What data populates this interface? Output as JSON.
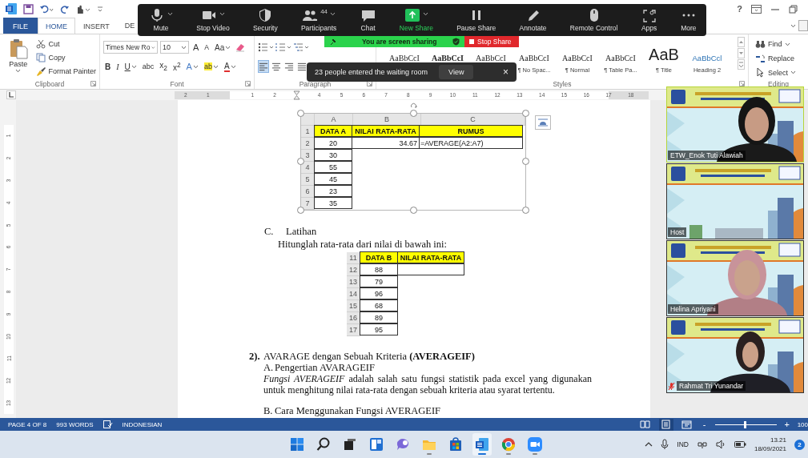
{
  "window_controls": {
    "help": "?"
  },
  "ribbon_tabs": [
    {
      "label": "FILE",
      "kind": "file",
      "selected": false
    },
    {
      "label": "HOME",
      "kind": "tab",
      "selected": true
    },
    {
      "label": "INSERT",
      "kind": "tab",
      "selected": false
    },
    {
      "label": "DE",
      "kind": "tab",
      "selected": false
    }
  ],
  "clipboard": {
    "label": "Clipboard",
    "paste": "Paste",
    "items": [
      {
        "kind": "cut",
        "label": "Cut"
      },
      {
        "kind": "copy",
        "label": "Copy"
      },
      {
        "kind": "painter",
        "label": "Format Painter"
      }
    ]
  },
  "font": {
    "label": "Font",
    "name": "Times New Ro",
    "size": "10",
    "row1": [
      {
        "kind": "grow",
        "text": "A"
      },
      {
        "kind": "shrink",
        "text": "A"
      },
      {
        "kind": "case",
        "text": "Aa"
      },
      {
        "kind": "clear"
      }
    ],
    "row2": [
      {
        "kind": "bold",
        "text": "B"
      },
      {
        "kind": "italic",
        "text": "I"
      },
      {
        "kind": "underline",
        "text": "U"
      },
      {
        "kind": "strike",
        "text": "abc"
      },
      {
        "kind": "sub",
        "text": "x$_{2}$"
      },
      {
        "kind": "sup",
        "text": "x$^{2}$"
      },
      {
        "kind": "effects",
        "text": "A"
      },
      {
        "kind": "highlight",
        "text": "ab"
      },
      {
        "kind": "color",
        "text": "A"
      }
    ]
  },
  "paragraph": {
    "label": "Paragraph",
    "alignments": [
      {
        "kind": "left",
        "selected": true
      },
      {
        "kind": "center",
        "selected": false
      },
      {
        "kind": "right",
        "selected": false
      },
      {
        "kind": "justify",
        "selected": false
      }
    ]
  },
  "styles": {
    "label": "Styles",
    "items": [
      {
        "kind": "body",
        "sample": "AaBbCcI"
      },
      {
        "kind": "heading1",
        "sample": "AaBbCcI"
      },
      {
        "kind": "list",
        "sample": "AaBbCcI"
      },
      {
        "kind": "plain",
        "sample": "AaBbCcI",
        "name": "¶ No Spac..."
      },
      {
        "kind": "plain",
        "sample": "AaBbCcI",
        "name": "¶ Normal"
      },
      {
        "kind": "plain",
        "sample": "AaBbCcI",
        "name": "¶ Table Pa..."
      },
      {
        "kind": "title",
        "sample": "AaB",
        "name": "¶ Title"
      },
      {
        "kind": "heading2",
        "sample": "AaBbCcl",
        "name": "Heading 2"
      }
    ]
  },
  "editing": {
    "label": "Editing",
    "items": [
      {
        "kind": "find",
        "label": "Find",
        "caret": true
      },
      {
        "kind": "replace",
        "label": "Replace",
        "caret": false
      },
      {
        "kind": "select",
        "label": "Select",
        "caret": true
      }
    ]
  },
  "meeting_toolbar": {
    "buttons": [
      {
        "label": "Mute",
        "kind": "mic",
        "caret": true
      },
      {
        "label": "Stop Video",
        "kind": "video",
        "caret": true
      },
      {
        "label": "Security",
        "kind": "security",
        "caret": false
      },
      {
        "label": "Participants",
        "kind": "participants",
        "caret": true,
        "count": "44"
      },
      {
        "label": "Chat",
        "kind": "chat",
        "caret": false
      },
      {
        "label": "New Share",
        "kind": "share",
        "caret": true
      },
      {
        "label": "Pause Share",
        "kind": "pause",
        "caret": false
      },
      {
        "label": "Annotate",
        "kind": "annotate",
        "caret": false
      },
      {
        "label": "Remote Control",
        "kind": "remote",
        "caret": false
      },
      {
        "label": "Apps",
        "kind": "apps",
        "caret": false
      },
      {
        "label": "More",
        "kind": "more",
        "caret": false
      }
    ]
  },
  "sharing_banner": {
    "text": "You are screen sharing",
    "stop": "Stop Share"
  },
  "waiting_toast": {
    "text": "23 people entered the waiting room",
    "action": "View",
    "close": "×"
  },
  "ruler": [
    {
      "kind": "number",
      "text": "2"
    },
    {
      "kind": "number",
      "text": "1"
    },
    {
      "kind": "margin"
    },
    {
      "kind": "number",
      "text": "1"
    },
    {
      "kind": "number",
      "text": "2"
    },
    {
      "kind": "indent"
    },
    {
      "kind": "number",
      "text": "4"
    },
    {
      "kind": "number",
      "text": "5"
    },
    {
      "kind": "number",
      "text": "6"
    },
    {
      "kind": "number",
      "text": "7"
    },
    {
      "kind": "number",
      "text": "8"
    },
    {
      "kind": "number",
      "text": "9"
    },
    {
      "kind": "number",
      "text": "10"
    },
    {
      "kind": "number",
      "text": "11"
    },
    {
      "kind": "number",
      "text": "12"
    },
    {
      "kind": "number",
      "text": "13"
    },
    {
      "kind": "number",
      "text": "14"
    },
    {
      "kind": "number",
      "text": "15"
    },
    {
      "kind": "number",
      "text": "16"
    },
    {
      "kind": "number",
      "text": "17"
    },
    {
      "kind": "number",
      "text": "18"
    }
  ],
  "vertical_ruler": [
    "1",
    "2",
    "3",
    "4",
    "5",
    "6",
    "7",
    "8",
    "9",
    "10",
    "11",
    "12",
    "13"
  ],
  "document": {
    "sheet_image": {
      "selected": true,
      "columns": [
        "A",
        "B",
        "C"
      ],
      "rows": [
        {
          "number": "1",
          "header": true,
          "cells": [
            "DATA A",
            "NILAI RATA-RATA",
            "RUMUS"
          ]
        },
        {
          "number": "2",
          "header": false,
          "cells": [
            "20",
            "34.67",
            "=AVERAGE(A2:A7)"
          ]
        },
        {
          "number": "3",
          "header": false,
          "cells": [
            "30"
          ]
        },
        {
          "number": "4",
          "header": false,
          "cells": [
            "55"
          ]
        },
        {
          "number": "5",
          "header": false,
          "cells": [
            "45"
          ]
        },
        {
          "number": "6",
          "header": false,
          "cells": [
            "23"
          ]
        },
        {
          "number": "7",
          "header": false,
          "cells": [
            "35"
          ]
        }
      ]
    },
    "section_c": {
      "marker": "C.",
      "title": "Latihan",
      "instruction": "Hitunglah rata-rata dari nilai di bawah ini:"
    },
    "exercise_table": {
      "rows": [
        {
          "number": "11",
          "header": true,
          "blank_cell": false,
          "cells": [
            "DATA B",
            "NILAI RATA-RATA"
          ]
        },
        {
          "number": "12",
          "header": false,
          "blank_cell": true,
          "cells": [
            "88"
          ]
        },
        {
          "number": "13",
          "header": false,
          "blank_cell": false,
          "cells": [
            "79"
          ]
        },
        {
          "number": "14",
          "header": false,
          "blank_cell": false,
          "cells": [
            "96"
          ]
        },
        {
          "number": "15",
          "header": false,
          "blank_cell": false,
          "cells": [
            "68"
          ]
        },
        {
          "number": "16",
          "header": false,
          "blank_cell": false,
          "cells": [
            "89"
          ]
        },
        {
          "number": "17",
          "header": false,
          "blank_cell": false,
          "cells": [
            "95"
          ]
        }
      ]
    },
    "heading": {
      "number": "2).",
      "text": "AVARAGE dengan Sebuah Kriteria **(AVERAGEIF)**"
    },
    "sub_a": {
      "marker": "A.",
      "text": "Pengertian AVARAGEIF"
    },
    "body": "*Fungsi AVERAGEIF* adalah salah satu fungsi statistik pada excel yang digunakan untuk menghitung nilai rata-rata dengan sebuah kriteria atau syarat tertentu.",
    "sub_b": {
      "marker": "B.",
      "text": "Cara Menggunakan Fungsi AVERAGEIF"
    }
  },
  "video_tiles": [
    {
      "name": "ETW_Enok Tuti Alawiah",
      "speaking": true,
      "muted": false
    },
    {
      "name": "Host",
      "speaking": false,
      "muted": false
    },
    {
      "name": "Helina Apriyani",
      "speaking": false,
      "muted": false
    },
    {
      "name": "Rahmat Tri Yunandar",
      "speaking": false,
      "muted": true
    }
  ],
  "status_bar": {
    "items": [
      "PAGE 4 OF 8",
      "993 WORDS"
    ],
    "language": "INDONESIAN",
    "views": [
      {
        "kind": "read",
        "selected": false
      },
      {
        "kind": "print",
        "selected": true
      },
      {
        "kind": "web",
        "selected": false
      }
    ],
    "zoom_out": "-",
    "zoom_in": "+",
    "zoom": {
      "level": 0.48
    },
    "zoom_text": "100"
  },
  "taskbar": {
    "apps": [
      {
        "kind": "start",
        "running": false,
        "selected": false
      },
      {
        "kind": "search",
        "running": false,
        "selected": false
      },
      {
        "kind": "taskview",
        "running": false,
        "selected": false
      },
      {
        "kind": "widgets",
        "running": false,
        "selected": false
      },
      {
        "kind": "chat",
        "running": false,
        "selected": false
      },
      {
        "kind": "explorer",
        "running": true,
        "selected": false
      },
      {
        "kind": "store",
        "running": false,
        "selected": false
      },
      {
        "kind": "word",
        "running": true,
        "selected": true
      },
      {
        "kind": "chrome",
        "running": true,
        "selected": false
      },
      {
        "kind": "zoom",
        "running": true,
        "selected": false
      }
    ],
    "language": "IND",
    "time": "13.21",
    "date": "18/09/2021",
    "notifications": "2"
  }
}
